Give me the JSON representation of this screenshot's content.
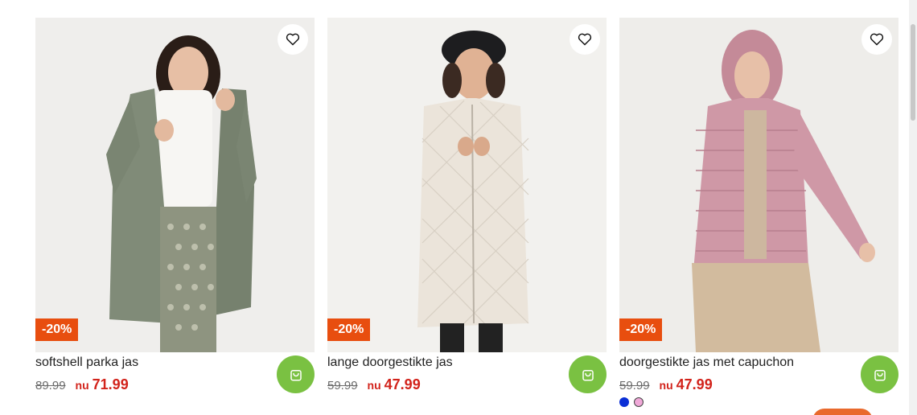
{
  "products": [
    {
      "title": "softshell parka jas",
      "old_price": "89.99",
      "now_label": "nu",
      "now_price": "71.99",
      "discount": "-20%",
      "wishlist_icon": "heart-icon",
      "cart_icon": "shopping-bag-icon",
      "swatches": []
    },
    {
      "title": "lange doorgestikte jas",
      "old_price": "59.99",
      "now_label": "nu",
      "now_price": "47.99",
      "discount": "-20%",
      "wishlist_icon": "heart-icon",
      "cart_icon": "shopping-bag-icon",
      "swatches": []
    },
    {
      "title": "doorgestikte jas met capuchon",
      "old_price": "59.99",
      "now_label": "nu",
      "now_price": "47.99",
      "discount": "-20%",
      "wishlist_icon": "heart-icon",
      "cart_icon": "shopping-bag-icon",
      "swatches": [
        {
          "color": "#0a2fd6"
        },
        {
          "color": "#f0a8d8"
        }
      ]
    }
  ],
  "colors": {
    "discount_badge": "#e84e0f",
    "cart_button": "#7ac142",
    "sale_price": "#d2231b"
  }
}
